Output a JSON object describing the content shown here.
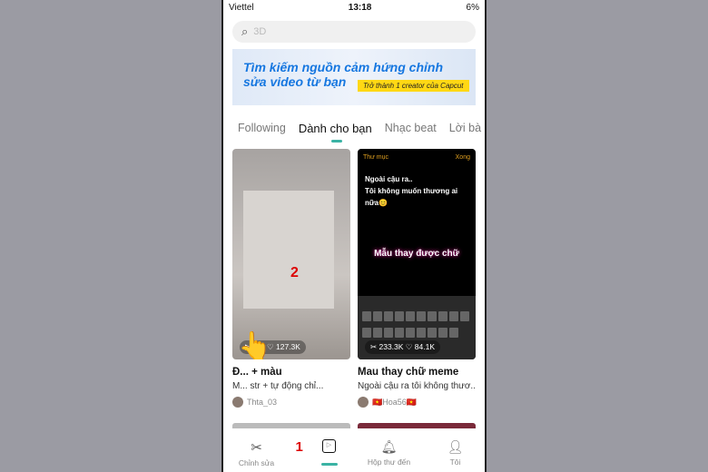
{
  "status": {
    "carrier": "Viettel",
    "time": "13:18",
    "battery": "6%"
  },
  "search": {
    "placeholder": "3D"
  },
  "banner": {
    "title": "Tìm kiếm nguồn cảm hứng chỉnh sửa video từ bạn",
    "cta": "Trở thành 1 creator của Capcut"
  },
  "tabs": [
    {
      "label": "Following"
    },
    {
      "label": "Dành cho bạn"
    },
    {
      "label": "Nhạc beat"
    },
    {
      "label": "Lời bà"
    }
  ],
  "cards": [
    {
      "title": "Đ... + màu",
      "desc": "M... str + tự động chỉ...",
      "author": "Thta_03",
      "uses": "...K",
      "likes": "127.3K",
      "overlay": "2"
    },
    {
      "title": "Mau thay chữ meme",
      "desc": "Ngoài cậu ra tôi không thươ...",
      "author": "🇻🇳Hoa56🇻🇳",
      "uses": "233.3K",
      "likes": "84.1K",
      "screen": {
        "back": "Thư mục",
        "done": "Xong",
        "text1": "Ngoài cậu ra..",
        "text2": "Tôi không muốn thương ai nữa😊",
        "caption": "Mẫu thay được chữ"
      }
    }
  ],
  "nav": [
    {
      "label": "Chỉnh sửa",
      "icon": "scissors-icon"
    },
    {
      "label": "",
      "icon": "template-icon",
      "badge": "1"
    },
    {
      "label": "Hộp thư đến",
      "icon": "bell-icon"
    },
    {
      "label": "Tôi",
      "icon": "user-icon"
    }
  ],
  "colors": {
    "accent": "#3bb3a4",
    "banner_text": "#1677e0",
    "banner_cta": "#ffd814"
  }
}
